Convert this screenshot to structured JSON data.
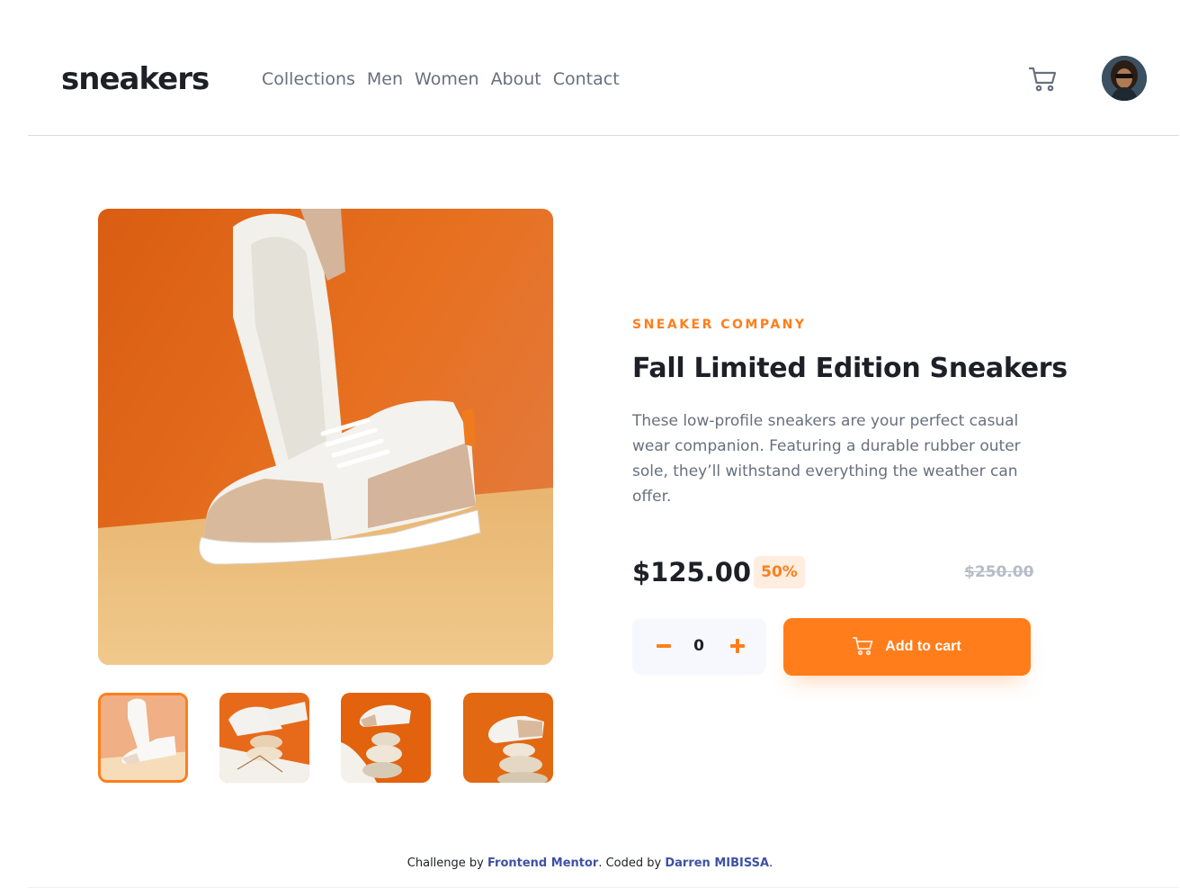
{
  "header": {
    "logo": "sneakers",
    "nav": [
      "Collections",
      "Men",
      "Women",
      "About",
      "Contact"
    ]
  },
  "product": {
    "company": "SNEAKER COMPANY",
    "title": "Fall Limited Edition Sneakers",
    "description": "These low-profile sneakers are your perfect casual wear companion. Featuring a durable rubber outer sole, they’ll withstand everything the weather can offer.",
    "price": "$125.00",
    "discount": "50%",
    "old_price": "$250.00",
    "quantity": "0",
    "add_to_cart_label": "Add to cart"
  },
  "footer": {
    "prefix": "Challenge by ",
    "link1": "Frontend Mentor",
    "middle": ". Coded by ",
    "link2": "Darren MIBISSA",
    "suffix": "."
  },
  "colors": {
    "accent": "#ff7e1b",
    "accent_light": "#ffede0",
    "text_dark": "#1d2026",
    "text_gray": "#68707d",
    "text_light": "#b6bcc8",
    "footer_link": "#3e52a3"
  },
  "icons": [
    "cart-icon",
    "avatar",
    "minus-icon",
    "plus-icon"
  ]
}
